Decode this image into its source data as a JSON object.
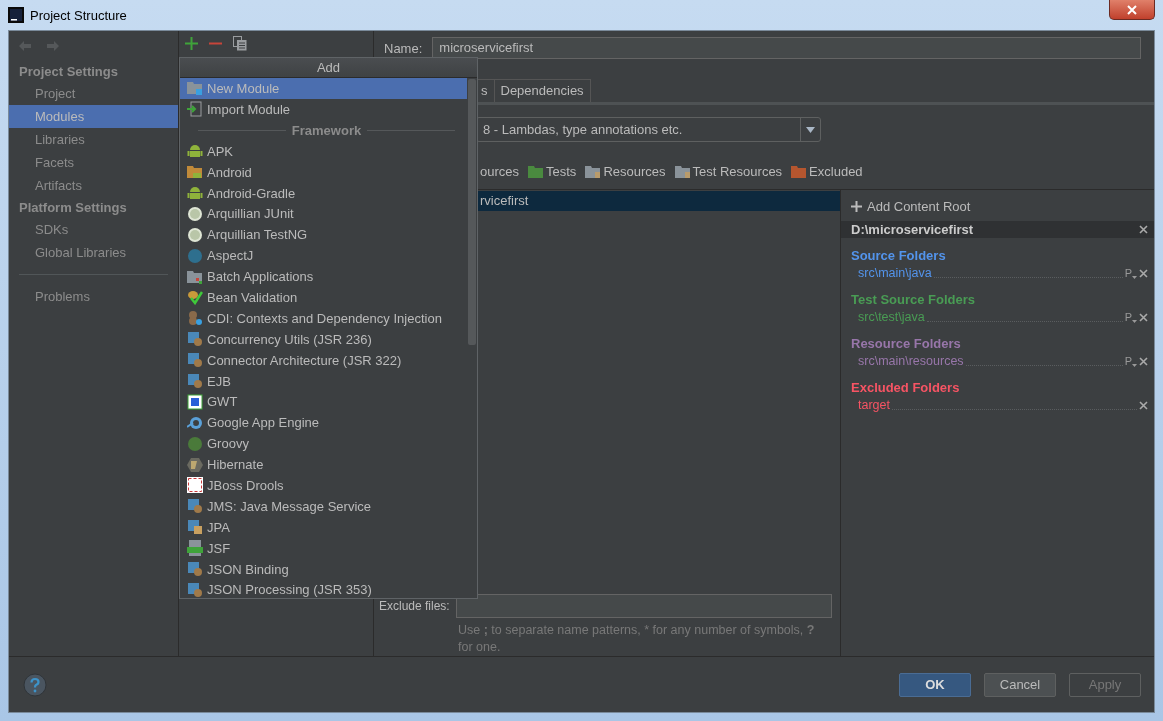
{
  "window": {
    "title": "Project Structure"
  },
  "sidebar": {
    "sections": [
      {
        "heading": "Project Settings",
        "items": [
          {
            "label": "Project",
            "selected": false
          },
          {
            "label": "Modules",
            "selected": true
          },
          {
            "label": "Libraries",
            "selected": false
          },
          {
            "label": "Facets",
            "selected": false
          },
          {
            "label": "Artifacts",
            "selected": false
          }
        ]
      },
      {
        "heading": "Platform Settings",
        "items": [
          {
            "label": "SDKs",
            "selected": false
          },
          {
            "label": "Global Libraries",
            "selected": false
          }
        ]
      }
    ],
    "extra_items": [
      {
        "label": "Problems",
        "selected": false
      }
    ]
  },
  "module": {
    "name_label": "Name:",
    "name": "microservicefirst",
    "tabs": [
      {
        "label": "s",
        "selected": false
      },
      {
        "label": "Dependencies",
        "selected": false
      }
    ],
    "language_level": "8 - Lambdas, type annotations etc.",
    "mark_as": [
      {
        "label": "ources",
        "kind": "sources"
      },
      {
        "label": "Tests",
        "kind": "tests"
      },
      {
        "label": "Resources",
        "kind": "resources"
      },
      {
        "label": "Test Resources",
        "kind": "test_resources"
      },
      {
        "label": "Excluded",
        "kind": "excluded"
      }
    ],
    "tree": [
      {
        "label": "rvicefirst",
        "selected": true
      }
    ],
    "exclude_files_label": "Exclude files:",
    "exclude_hint": "Use **;** to separate name patterns, * for any number of symbols, **?** for one."
  },
  "content_root": {
    "add_label": "Add Content Root",
    "path": "D:\\microservicefirst",
    "groups": [
      {
        "title": "Source Folders",
        "color": "#5394ec",
        "folders": [
          {
            "path": "src\\main\\java",
            "prefix": "P"
          }
        ]
      },
      {
        "title": "Test Source Folders",
        "color": "#499c54",
        "folders": [
          {
            "path": "src\\test\\java",
            "prefix": "P"
          }
        ]
      },
      {
        "title": "Resource Folders",
        "color": "#9876aa",
        "folders": [
          {
            "path": "src\\main\\resources",
            "prefix": "P"
          }
        ]
      },
      {
        "title": "Excluded Folders",
        "color": "#f75464",
        "folders": [
          {
            "path": "target"
          }
        ]
      }
    ]
  },
  "buttons": [
    {
      "label": "OK",
      "default": true,
      "disabled": false
    },
    {
      "label": "Cancel",
      "default": false,
      "disabled": false
    },
    {
      "label": "Apply",
      "default": false,
      "disabled": true
    }
  ],
  "popup": {
    "title": "Add",
    "items": [
      {
        "kind": "item",
        "label": "New Module",
        "selected": true
      },
      {
        "kind": "item",
        "label": "Import Module",
        "selected": false
      },
      {
        "kind": "separator",
        "label": "Framework"
      },
      {
        "kind": "item",
        "label": "APK",
        "selected": false
      },
      {
        "kind": "item",
        "label": "Android",
        "selected": false
      },
      {
        "kind": "item",
        "label": "Android-Gradle",
        "selected": false
      },
      {
        "kind": "item",
        "label": "Arquillian JUnit",
        "selected": false
      },
      {
        "kind": "item",
        "label": "Arquillian TestNG",
        "selected": false
      },
      {
        "kind": "item",
        "label": "AspectJ",
        "selected": false
      },
      {
        "kind": "item",
        "label": "Batch Applications",
        "selected": false
      },
      {
        "kind": "item",
        "label": "Bean Validation",
        "selected": false
      },
      {
        "kind": "item",
        "label": "CDI: Contexts and Dependency Injection",
        "selected": false
      },
      {
        "kind": "item",
        "label": "Concurrency Utils (JSR 236)",
        "selected": false
      },
      {
        "kind": "item",
        "label": "Connector Architecture (JSR 322)",
        "selected": false
      },
      {
        "kind": "item",
        "label": "EJB",
        "selected": false
      },
      {
        "kind": "item",
        "label": "GWT",
        "selected": false
      },
      {
        "kind": "item",
        "label": "Google App Engine",
        "selected": false
      },
      {
        "kind": "item",
        "label": "Groovy",
        "selected": false
      },
      {
        "kind": "item",
        "label": "Hibernate",
        "selected": false
      },
      {
        "kind": "item",
        "label": "JBoss Drools",
        "selected": false
      },
      {
        "kind": "item",
        "label": "JMS: Java Message Service",
        "selected": false
      },
      {
        "kind": "item",
        "label": "JPA",
        "selected": false
      },
      {
        "kind": "item",
        "label": "JSF",
        "selected": false
      },
      {
        "kind": "item",
        "label": "JSON Binding",
        "selected": false
      },
      {
        "kind": "item",
        "label": "JSON Processing (JSR 353)",
        "selected": false
      }
    ]
  }
}
